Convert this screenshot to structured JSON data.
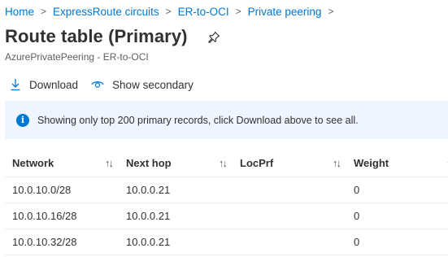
{
  "breadcrumb": {
    "items": [
      "Home",
      "ExpressRoute circuits",
      "ER-to-OCI",
      "Private peering"
    ],
    "separator": ">"
  },
  "page": {
    "title": "Route table (Primary)",
    "subtitle": "AzurePrivatePeering - ER-to-OCI"
  },
  "toolbar": {
    "download_label": "Download",
    "download_icon": "download-icon",
    "show_secondary_label": "Show secondary",
    "show_secondary_icon": "eye-icon"
  },
  "info": {
    "message": "Showing only top 200 primary records, click Download above to see all.",
    "icon": "info-icon"
  },
  "table": {
    "columns": [
      "Network",
      "Next hop",
      "LocPrf",
      "Weight"
    ],
    "sort_icon": "↑↓",
    "rows": [
      {
        "network": "10.0.10.0/28",
        "next_hop": "10.0.0.21",
        "locprf": "",
        "weight": "0"
      },
      {
        "network": "10.0.10.16/28",
        "next_hop": "10.0.0.21",
        "locprf": "",
        "weight": "0"
      },
      {
        "network": "10.0.10.32/28",
        "next_hop": "10.0.0.21",
        "locprf": "",
        "weight": "0"
      }
    ]
  },
  "colors": {
    "link": "#0078d4",
    "info_background": "#f0f6ff",
    "text": "#323130"
  }
}
